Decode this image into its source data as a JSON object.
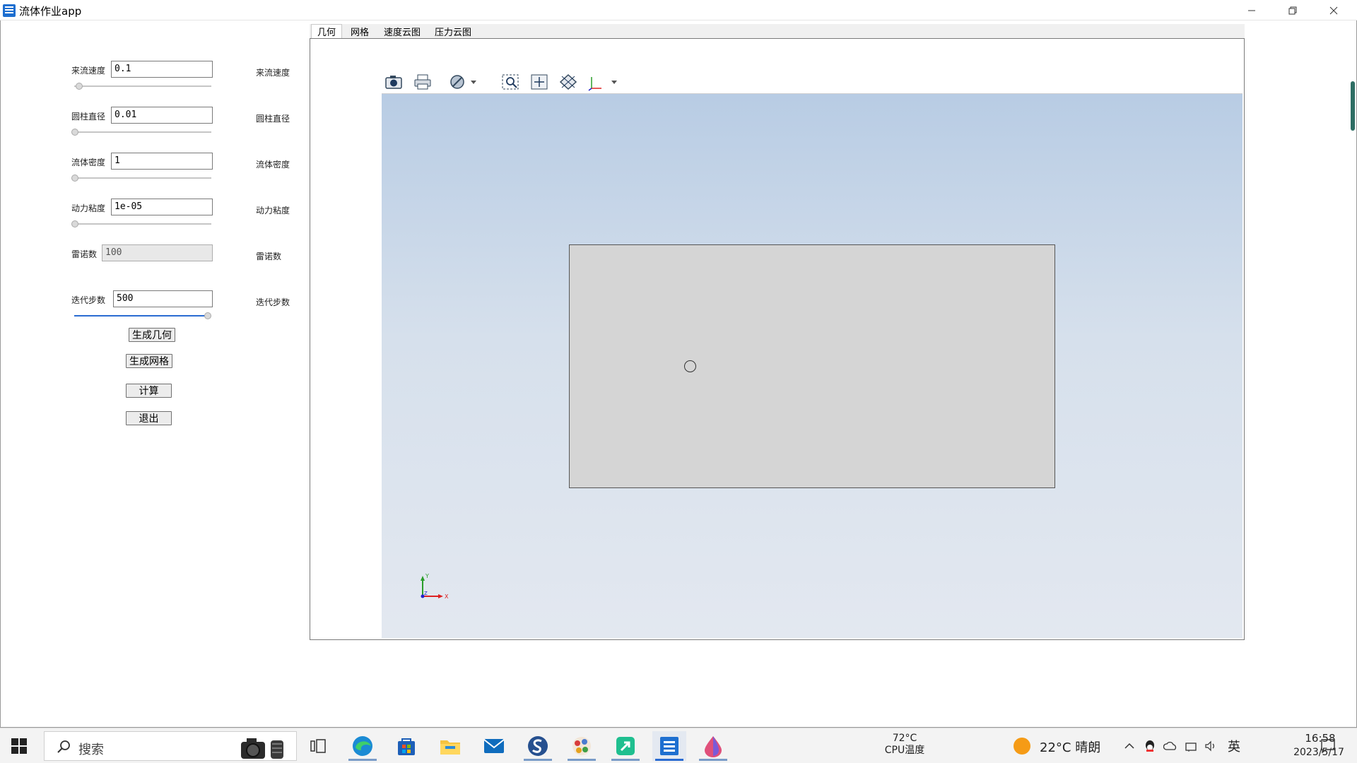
{
  "window": {
    "title": "流体作业app",
    "minimize_icon": "minimize-icon",
    "maximize_icon": "restore-icon",
    "close_icon": "close-icon"
  },
  "params": [
    {
      "label": "来流速度",
      "value": "0.1",
      "right_label": "来流速度",
      "slider_fraction": 0.04
    },
    {
      "label": "圆柱直径",
      "value": "0.01",
      "right_label": "圆柱直径",
      "slider_fraction": 0.0
    },
    {
      "label": "流体密度",
      "value": "1",
      "right_label": "流体密度",
      "slider_fraction": 0.0
    },
    {
      "label": "动力粘度",
      "value": "1e-05",
      "right_label": "动力粘度",
      "slider_fraction": 0.0
    },
    {
      "label": "雷诺数",
      "value": "100",
      "right_label": "雷诺数",
      "readonly": true
    },
    {
      "label": "迭代步数",
      "value": "500",
      "right_label": "迭代步数",
      "slider_fraction": 1.0
    }
  ],
  "buttons": {
    "geometry": "生成几何",
    "mesh": "生成网格",
    "compute": "计算",
    "exit": "退出"
  },
  "tabs": [
    "几何",
    "网格",
    "速度云图",
    "压力云图"
  ],
  "active_tab": "几何",
  "viewer_toolbar": [
    "camera-icon",
    "print-icon",
    "display-mode-icon",
    "zoom-box-icon",
    "fit-all-icon",
    "view-iso-icon",
    "axes-view-icon"
  ],
  "triad": {
    "x": "X",
    "y": "Y",
    "z": "Z"
  },
  "colors": {
    "viewport_top": "#b8cce4",
    "viewport_bottom": "#e3e8f0",
    "domain_fill": "#d5d5d5",
    "slider_active": "#2a6cd2"
  },
  "taskbar": {
    "search_placeholder": "搜索",
    "cpu_temp": "72°C",
    "cpu_label": "CPU温度",
    "weather": "22°C  晴朗",
    "ime": "英",
    "time": "16:58",
    "date": "2023/5/17",
    "apps": [
      "task-view-icon",
      "edge-icon",
      "store-icon",
      "file-explorer-icon",
      "mail-icon",
      "app-s-icon",
      "app-paint-icon",
      "app-arrow-icon",
      "fluid-app-icon",
      "app-drop-icon"
    ]
  }
}
